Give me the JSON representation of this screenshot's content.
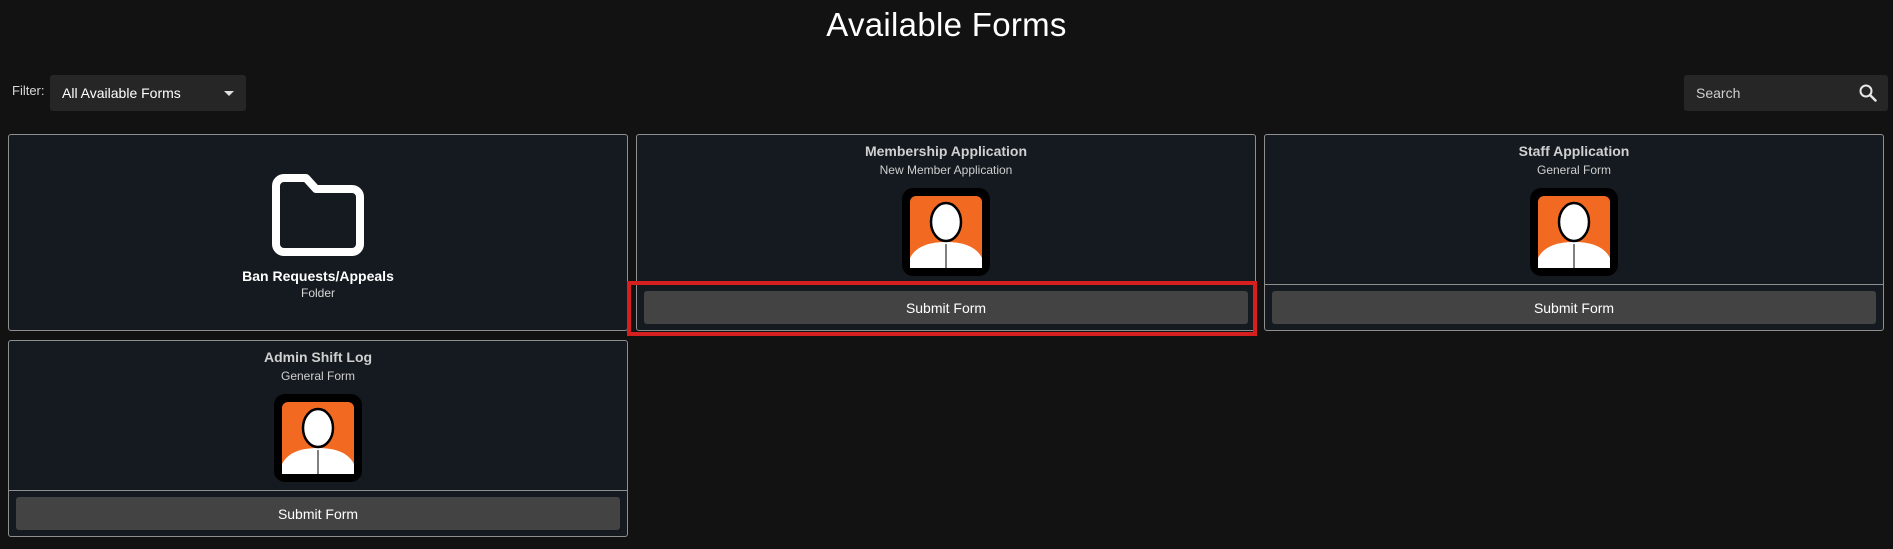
{
  "page": {
    "title": "Available Forms"
  },
  "filter": {
    "label": "Filter:",
    "selected": "All Available Forms"
  },
  "search": {
    "placeholder": "Search",
    "value": ""
  },
  "folder": {
    "title": "Ban Requests/Appeals",
    "subtitle": "Folder",
    "icon": "folder-icon"
  },
  "forms": [
    {
      "title": "Membership Application",
      "subtitle": "New Member Application",
      "button_label": "Submit Form",
      "icon": "avatar-icon"
    },
    {
      "title": "Staff Application",
      "subtitle": "General Form",
      "button_label": "Submit Form",
      "icon": "avatar-icon"
    },
    {
      "title": "Admin Shift Log",
      "subtitle": "General Form",
      "button_label": "Submit Form",
      "icon": "avatar-icon"
    }
  ],
  "colors": {
    "background": "#121212",
    "card_background": "#141a1f",
    "avatar_accent": "#f26a21",
    "highlight": "#d61f1f",
    "button": "#434343"
  }
}
